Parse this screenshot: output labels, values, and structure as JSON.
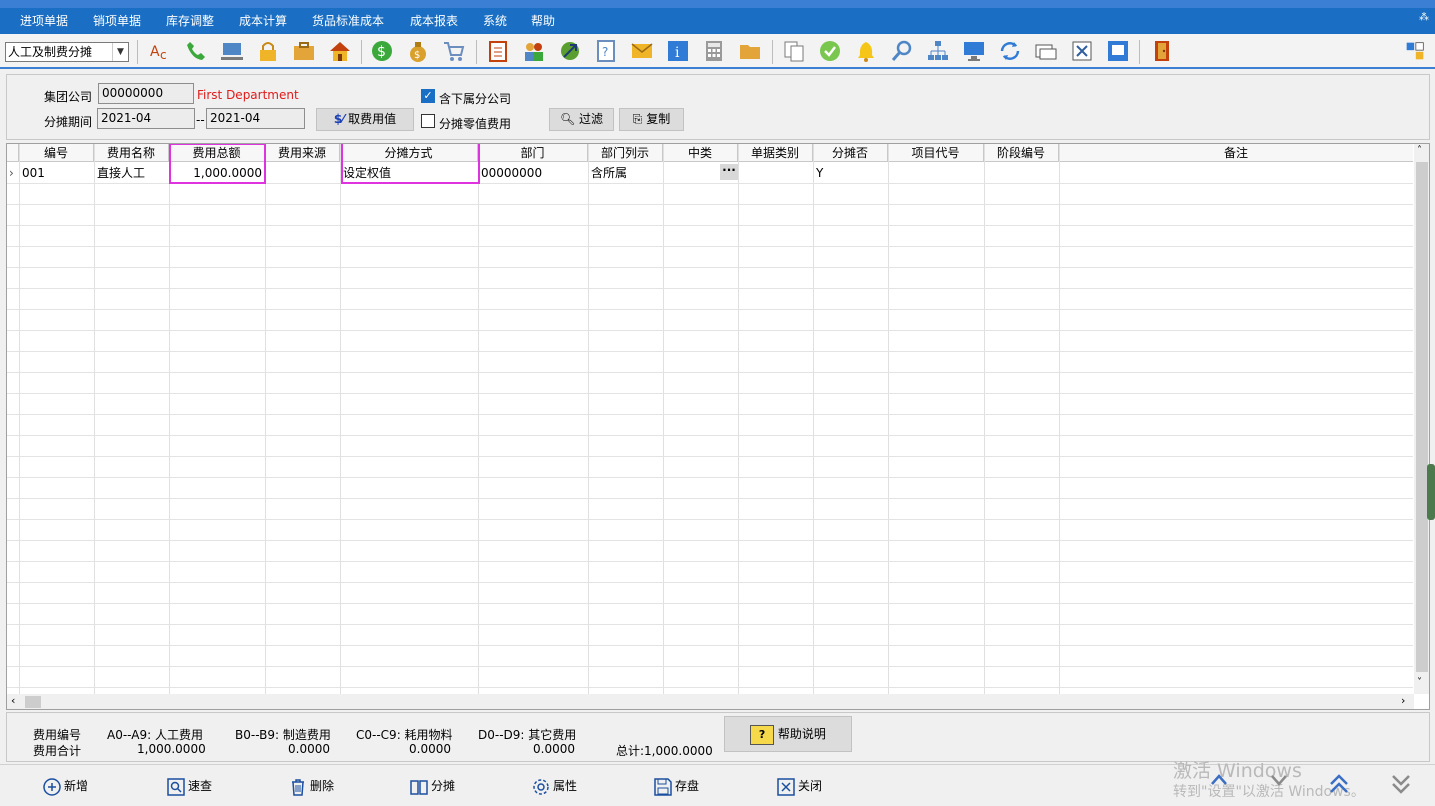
{
  "menu": [
    "进项单据",
    "销项单据",
    "库存调整",
    "成本计算",
    "货品标准成本",
    "成本报表",
    "系统",
    "帮助"
  ],
  "toolbar": {
    "module_select": "人工及制费分摊",
    "icons": [
      "spell-check-icon",
      "phone-icon",
      "monitor-icon",
      "lock-icon",
      "briefcase-icon",
      "home-icon",
      "dollar-icon",
      "money-bag-icon",
      "cart-icon",
      "clipboard-icon",
      "users-icon",
      "link-icon",
      "help-doc-icon",
      "mail-icon",
      "info-icon",
      "calculator-icon",
      "folder-icon",
      "copy-doc-icon",
      "check-icon",
      "bell-icon",
      "search-icon",
      "org-chart-icon",
      "desktop-icon",
      "refresh-icon",
      "window-icon",
      "close-box-icon",
      "restore-icon",
      "exit-door-icon"
    ]
  },
  "filter": {
    "group_company_label": "集团公司",
    "group_company_value": "00000000",
    "department_name": "First Department",
    "include_sub_label": "含下属分公司",
    "include_sub_checked": true,
    "period_label": "分摊期间",
    "period_from": "2021-04",
    "period_sep": "--",
    "period_to": "2021-04",
    "fetch_button": "取费用值",
    "small_fee_label": "分摊零值费用",
    "small_fee_checked": false,
    "filter_button": "过滤",
    "copy_button": "复制"
  },
  "grid": {
    "columns": [
      "编号",
      "费用名称",
      "费用总额",
      "费用来源",
      "分摊方式",
      "部门",
      "部门列示",
      "中类",
      "单据类别",
      "分摊否",
      "项目代号",
      "阶段编号",
      "备注"
    ],
    "rows": [
      {
        "code": "001",
        "name": "直接人工",
        "total": "1,000.0000",
        "source": "",
        "method": "设定权值",
        "dept": "00000000",
        "dept_list": "含所属",
        "mid": "",
        "doc_type": "",
        "alloc": "Y",
        "project": "",
        "stage": "",
        "note": ""
      }
    ]
  },
  "summary": {
    "labels": [
      "费用编号",
      "费用合计"
    ],
    "groups": [
      {
        "range": "A0--A9: 人工费用",
        "amount": "1,000.0000"
      },
      {
        "range": "B0--B9: 制造费用",
        "amount": "0.0000"
      },
      {
        "range": "C0--C9: 耗用物料",
        "amount": "0.0000"
      },
      {
        "range": "D0--D9: 其它费用",
        "amount": "0.0000"
      }
    ],
    "total": "总计:1,000.0000",
    "help_button": "帮助说明"
  },
  "bottom": {
    "buttons": [
      "新增",
      "速查",
      "删除",
      "分摊",
      "属性",
      "存盘",
      "关闭"
    ],
    "watermark_line1": "激活 Windows",
    "watermark_line2": "转到\"设置\"以激活 Windows。"
  }
}
